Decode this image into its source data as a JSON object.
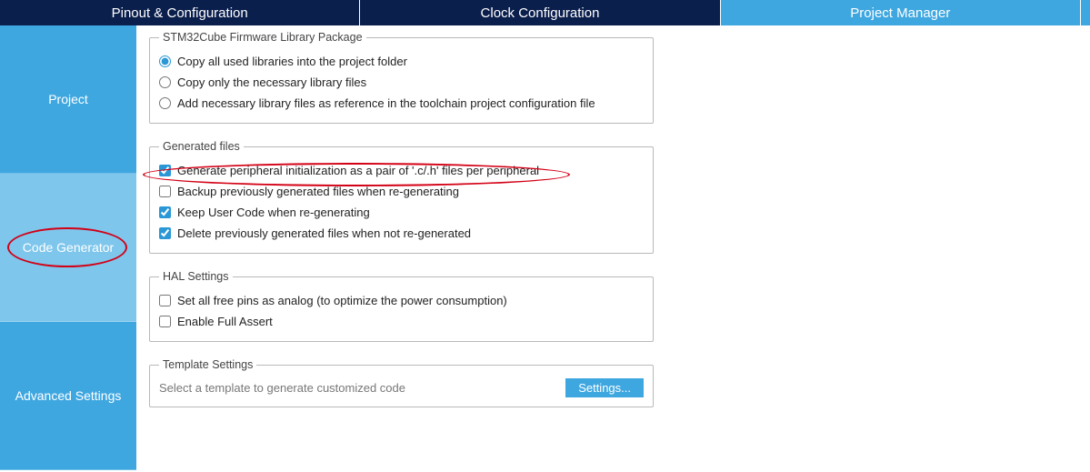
{
  "tabs": {
    "pinout": "Pinout & Configuration",
    "clock": "Clock Configuration",
    "project": "Project Manager"
  },
  "sidebar": {
    "items": [
      {
        "label": "Project"
      },
      {
        "label": "Code Generator"
      },
      {
        "label": "Advanced Settings"
      }
    ]
  },
  "firmware": {
    "legend": "STM32Cube Firmware Library Package",
    "opt1": "Copy all used libraries into the project folder",
    "opt2": "Copy only the necessary library files",
    "opt3": "Add necessary library files as reference in the toolchain project configuration file"
  },
  "generated": {
    "legend": "Generated files",
    "chk1": "Generate peripheral initialization as a pair of '.c/.h' files per peripheral",
    "chk2": "Backup previously generated files when re-generating",
    "chk3": "Keep User Code when re-generating",
    "chk4": "Delete previously generated files when not re-generated"
  },
  "hal": {
    "legend": "HAL Settings",
    "chk1": "Set all free pins as analog (to optimize the power consumption)",
    "chk2": "Enable Full Assert"
  },
  "template": {
    "legend": "Template Settings",
    "text": "Select a template to generate customized code",
    "button": "Settings..."
  }
}
